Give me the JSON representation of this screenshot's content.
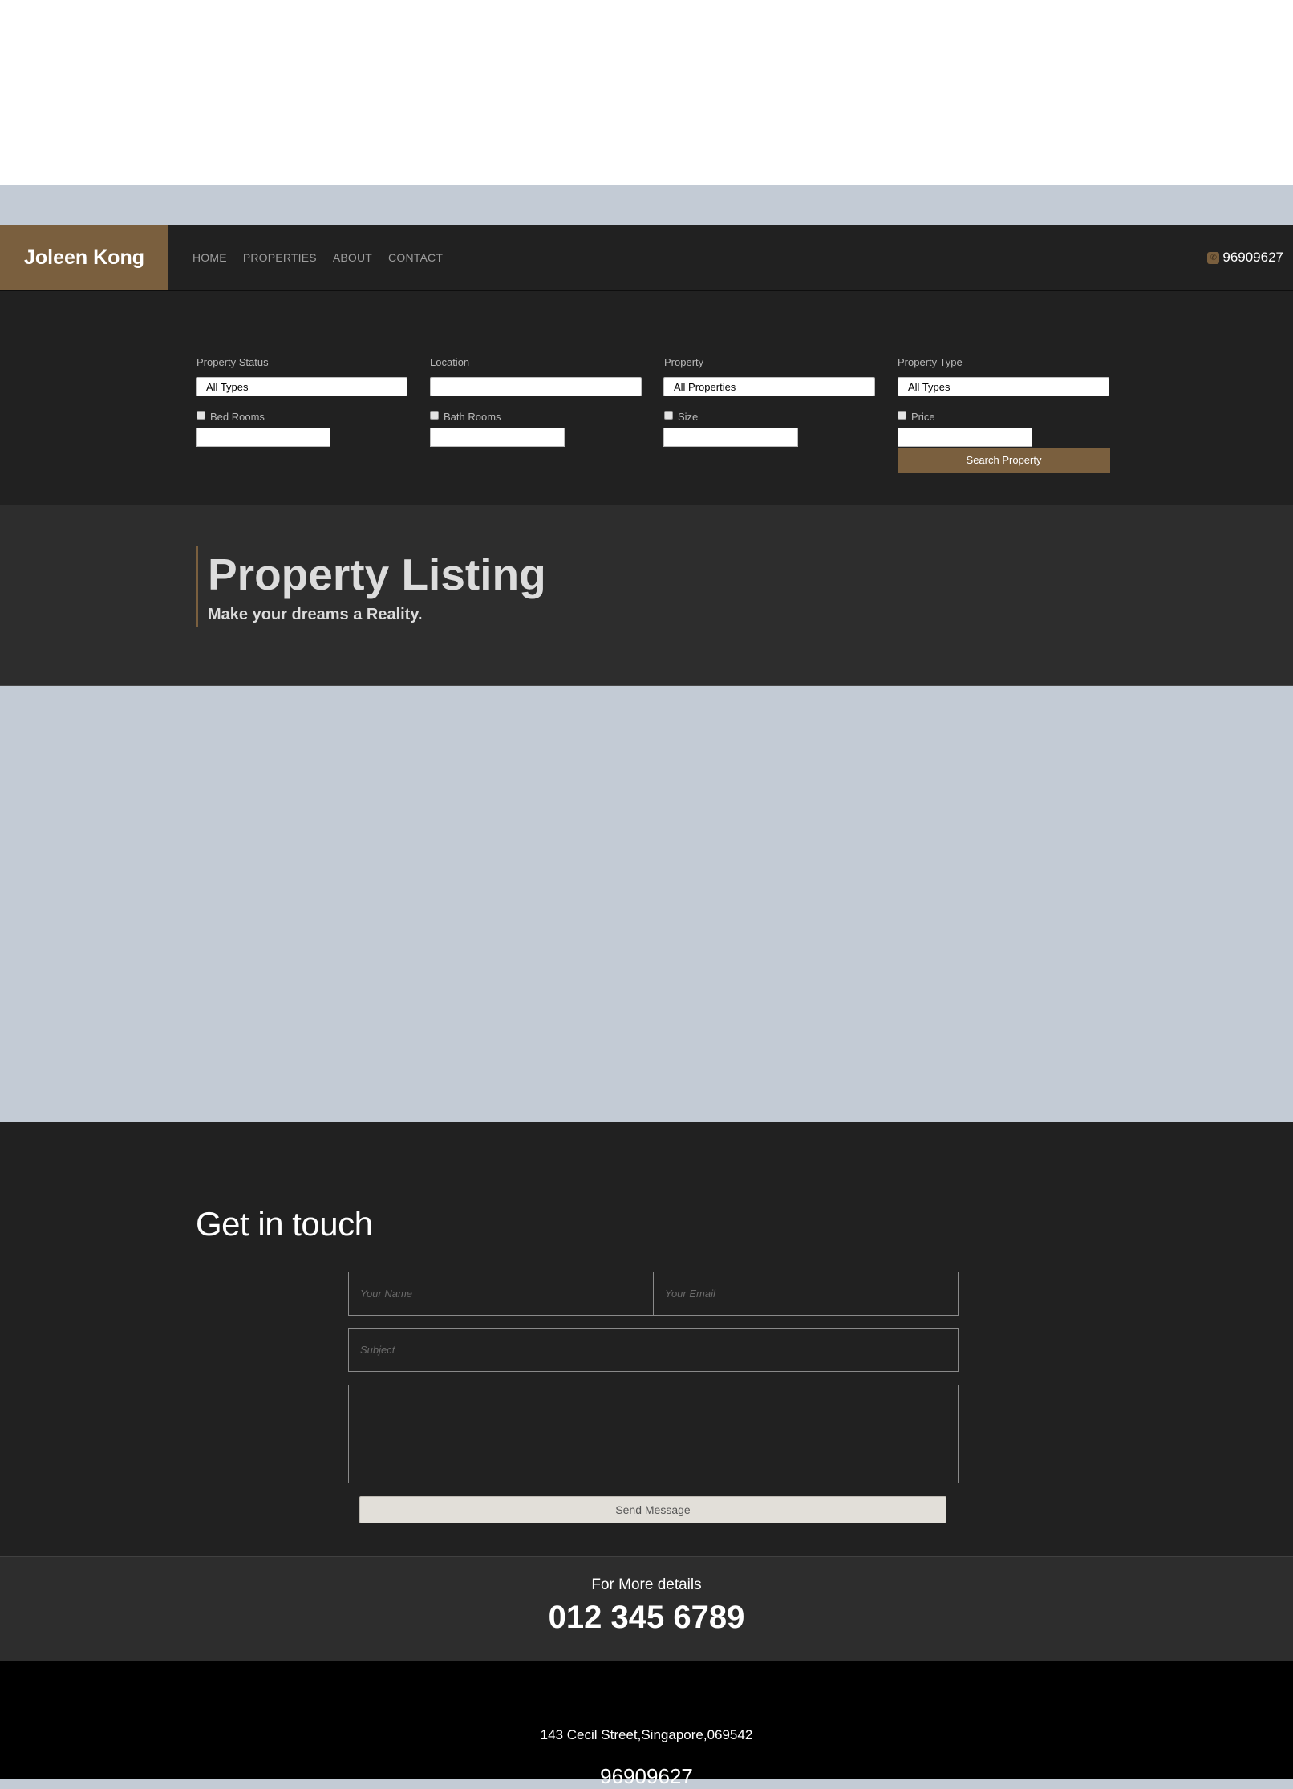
{
  "nav": {
    "brand": "Joleen Kong",
    "links": [
      "HOME",
      "PROPERTIES",
      "ABOUT",
      "CONTACT"
    ],
    "phone": "96909627",
    "phone_icon": "phone-icon"
  },
  "search": {
    "fields": [
      {
        "label": "Property Status",
        "selected": "All Types",
        "check_label": "Bed Rooms"
      },
      {
        "label": "Location",
        "selected": "",
        "check_label": "Bath Rooms"
      },
      {
        "label": "Property",
        "selected": "All Properties",
        "check_label": "Size"
      },
      {
        "label": "Property Type",
        "selected": "All Types",
        "check_label": "Price"
      }
    ],
    "button_label": "Search Property"
  },
  "listing": {
    "title": "Property Listing",
    "subtitle": "Make your dreams a Reality."
  },
  "contact": {
    "heading": "Get in touch",
    "name_placeholder": "Your Name",
    "email_placeholder": "Your Email",
    "subject_placeholder": "Subject",
    "message_placeholder": "",
    "send_label": "Send Message"
  },
  "details": {
    "label": "For More details",
    "phone": "012 345 6789"
  },
  "footer": {
    "address": "143 Cecil Street,Singapore,069542",
    "phone": "96909627"
  },
  "colors": {
    "accent": "#7a5f3e",
    "dark": "#212121",
    "panel": "#2d2d2d",
    "band": "#c3cbd5"
  }
}
